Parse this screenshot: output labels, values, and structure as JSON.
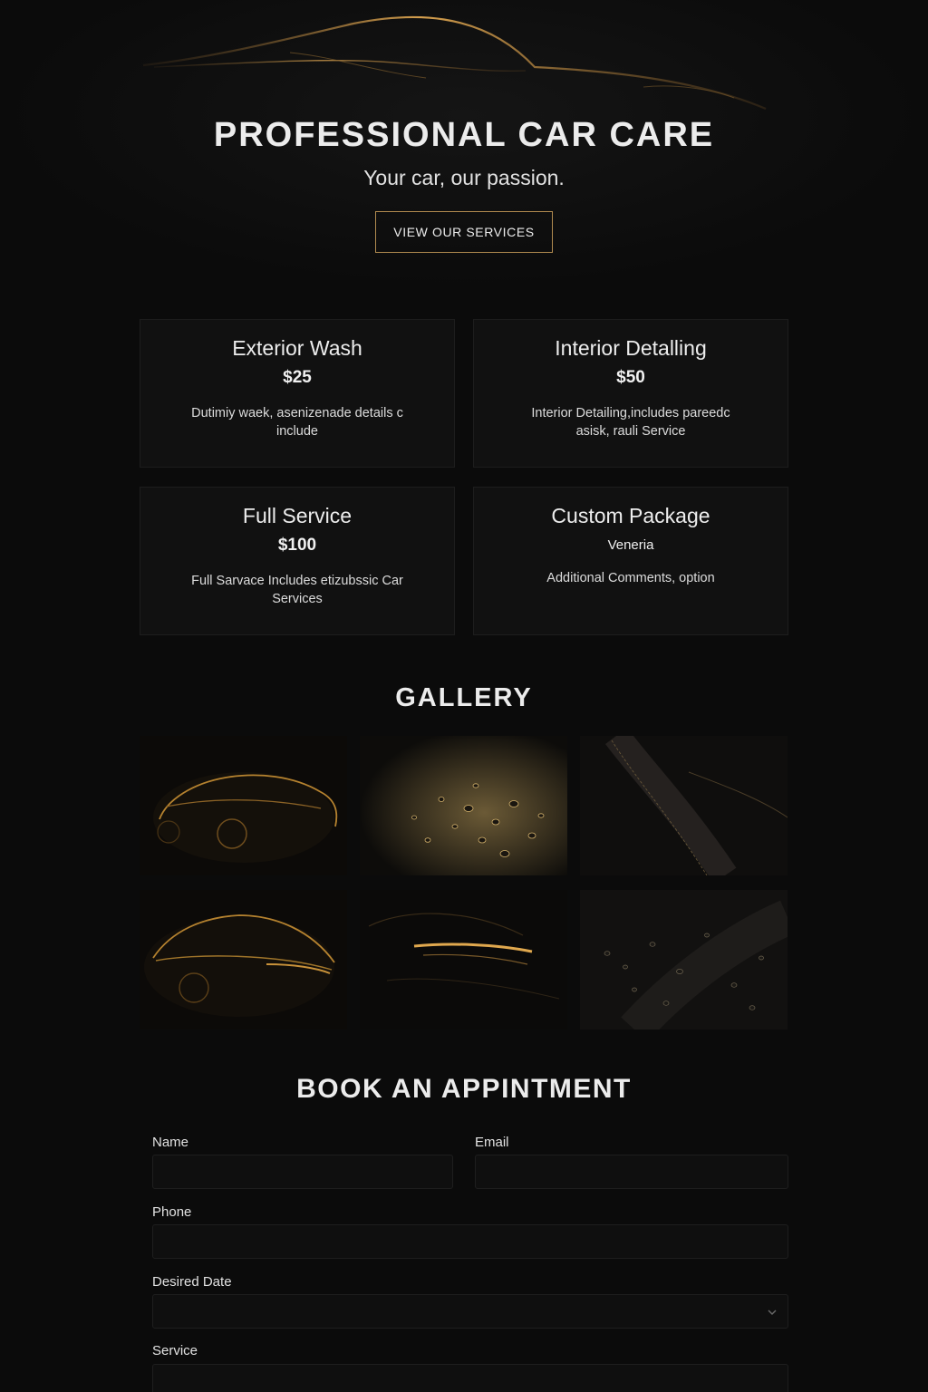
{
  "hero": {
    "title": "PROFESSIONAL CAR CARE",
    "subtitle": "Your car, our passion.",
    "button_label": "VIEW OUR SERVICES",
    "accent_color": "#c8923e"
  },
  "services": [
    {
      "name": "Exterior Wash",
      "price": "$25",
      "description": "Dutimiy waek, asenizenade details c include"
    },
    {
      "name": "Interior Detalling",
      "price": "$50",
      "description": "Interior Detailing,includes pareedc asisk, rauli Service"
    },
    {
      "name": "Full Service",
      "price": "$100",
      "description": "Full Sarvace Includes etizubssic Car Services"
    },
    {
      "name": "Custom Package",
      "price": "Veneria",
      "description": "Additional Comments, option"
    }
  ],
  "gallery": {
    "title": "GALLERY",
    "tiles": [
      {
        "icon": "car-silhouette"
      },
      {
        "icon": "water-droplets"
      },
      {
        "icon": "leather-seat"
      },
      {
        "icon": "car-silhouette"
      },
      {
        "icon": "car-headlight"
      },
      {
        "icon": "water-droplets"
      }
    ]
  },
  "booking": {
    "title": "BOOK AN APPINTMENT",
    "fields": {
      "name": {
        "label": "Name",
        "value": ""
      },
      "email": {
        "label": "Email",
        "value": ""
      },
      "phone": {
        "label": "Phone",
        "value": ""
      },
      "date": {
        "label": "Desired Date",
        "value": ""
      },
      "service": {
        "label": "Service",
        "value": ""
      }
    }
  }
}
